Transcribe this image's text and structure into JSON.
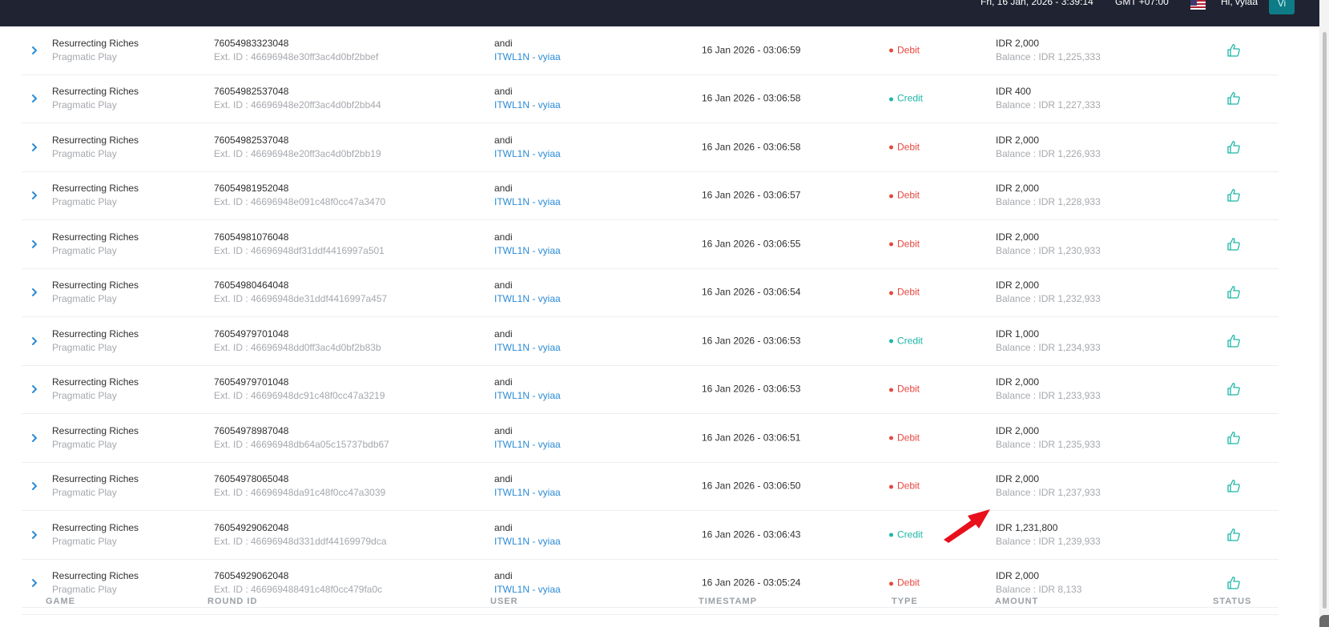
{
  "topbar": {
    "datetime": "Fri, 16 Jan, 2026 - 3:39:14",
    "timezone": "GMT +07:00",
    "greeting": "Hi, vyiaa",
    "avatar_initials": "Vi",
    "flag_icon": "us-flag-icon"
  },
  "table": {
    "headers": [
      "GAME",
      "ROUND ID",
      "USER",
      "TIMESTAMP",
      "TYPE",
      "AMOUNT",
      "STATUS"
    ],
    "rows": [
      {
        "game": "Resurrecting Riches",
        "provider": "Pragmatic Play",
        "round_id": "76054983323048",
        "ext_id": "Ext. ID : 46696948e30ff3ac4d0bf2bbef",
        "user": "andi",
        "user_link": "ITWL1N - vyiaa",
        "timestamp": "16 Jan 2026 - 03:06:59",
        "type": "Debit",
        "amount": "IDR 2,000",
        "balance": "Balance : IDR 1,225,333"
      },
      {
        "game": "Resurrecting Riches",
        "provider": "Pragmatic Play",
        "round_id": "76054982537048",
        "ext_id": "Ext. ID : 46696948e20ff3ac4d0bf2bb44",
        "user": "andi",
        "user_link": "ITWL1N - vyiaa",
        "timestamp": "16 Jan 2026 - 03:06:58",
        "type": "Credit",
        "amount": "IDR 400",
        "balance": "Balance : IDR 1,227,333"
      },
      {
        "game": "Resurrecting Riches",
        "provider": "Pragmatic Play",
        "round_id": "76054982537048",
        "ext_id": "Ext. ID : 46696948e20ff3ac4d0bf2bb19",
        "user": "andi",
        "user_link": "ITWL1N - vyiaa",
        "timestamp": "16 Jan 2026 - 03:06:58",
        "type": "Debit",
        "amount": "IDR 2,000",
        "balance": "Balance : IDR 1,226,933"
      },
      {
        "game": "Resurrecting Riches",
        "provider": "Pragmatic Play",
        "round_id": "76054981952048",
        "ext_id": "Ext. ID : 46696948e091c48f0cc47a3470",
        "user": "andi",
        "user_link": "ITWL1N - vyiaa",
        "timestamp": "16 Jan 2026 - 03:06:57",
        "type": "Debit",
        "amount": "IDR 2,000",
        "balance": "Balance : IDR 1,228,933"
      },
      {
        "game": "Resurrecting Riches",
        "provider": "Pragmatic Play",
        "round_id": "76054981076048",
        "ext_id": "Ext. ID : 46696948df31ddf4416997a501",
        "user": "andi",
        "user_link": "ITWL1N - vyiaa",
        "timestamp": "16 Jan 2026 - 03:06:55",
        "type": "Debit",
        "amount": "IDR 2,000",
        "balance": "Balance : IDR 1,230,933"
      },
      {
        "game": "Resurrecting Riches",
        "provider": "Pragmatic Play",
        "round_id": "76054980464048",
        "ext_id": "Ext. ID : 46696948de31ddf4416997a457",
        "user": "andi",
        "user_link": "ITWL1N - vyiaa",
        "timestamp": "16 Jan 2026 - 03:06:54",
        "type": "Debit",
        "amount": "IDR 2,000",
        "balance": "Balance : IDR 1,232,933"
      },
      {
        "game": "Resurrecting Riches",
        "provider": "Pragmatic Play",
        "round_id": "76054979701048",
        "ext_id": "Ext. ID : 46696948dd0ff3ac4d0bf2b83b",
        "user": "andi",
        "user_link": "ITWL1N - vyiaa",
        "timestamp": "16 Jan 2026 - 03:06:53",
        "type": "Credit",
        "amount": "IDR 1,000",
        "balance": "Balance : IDR 1,234,933"
      },
      {
        "game": "Resurrecting Riches",
        "provider": "Pragmatic Play",
        "round_id": "76054979701048",
        "ext_id": "Ext. ID : 46696948dc91c48f0cc47a3219",
        "user": "andi",
        "user_link": "ITWL1N - vyiaa",
        "timestamp": "16 Jan 2026 - 03:06:53",
        "type": "Debit",
        "amount": "IDR 2,000",
        "balance": "Balance : IDR 1,233,933"
      },
      {
        "game": "Resurrecting Riches",
        "provider": "Pragmatic Play",
        "round_id": "76054978987048",
        "ext_id": "Ext. ID : 46696948db64a05c15737bdb67",
        "user": "andi",
        "user_link": "ITWL1N - vyiaa",
        "timestamp": "16 Jan 2026 - 03:06:51",
        "type": "Debit",
        "amount": "IDR 2,000",
        "balance": "Balance : IDR 1,235,933"
      },
      {
        "game": "Resurrecting Riches",
        "provider": "Pragmatic Play",
        "round_id": "76054978065048",
        "ext_id": "Ext. ID : 46696948da91c48f0cc47a3039",
        "user": "andi",
        "user_link": "ITWL1N - vyiaa",
        "timestamp": "16 Jan 2026 - 03:06:50",
        "type": "Debit",
        "amount": "IDR 2,000",
        "balance": "Balance : IDR 1,237,933"
      },
      {
        "game": "Resurrecting Riches",
        "provider": "Pragmatic Play",
        "round_id": "76054929062048",
        "ext_id": "Ext. ID : 46696948d331ddf44169979dca",
        "user": "andi",
        "user_link": "ITWL1N - vyiaa",
        "timestamp": "16 Jan 2026 - 03:06:43",
        "type": "Credit",
        "amount": "IDR 1,231,800",
        "balance": "Balance : IDR 1,239,933"
      },
      {
        "game": "Resurrecting Riches",
        "provider": "Pragmatic Play",
        "round_id": "76054929062048",
        "ext_id": "Ext. ID : 466969488491c48f0cc479fa0c",
        "user": "andi",
        "user_link": "ITWL1N - vyiaa",
        "timestamp": "16 Jan 2026 - 03:05:24",
        "type": "Debit",
        "amount": "IDR 2,000",
        "balance": "Balance : IDR 8,133"
      }
    ]
  },
  "colors": {
    "topbar": "#202332",
    "debit": "#e8463f",
    "credit": "#1cb6a6",
    "link": "#2b8bd6",
    "status_icon": "#1cb6a6",
    "annotation_arrow": "#e8101a"
  },
  "icons": {
    "expand": "chevron-right-icon",
    "status": "thumbs-up-icon",
    "annotation": "red-arrow-icon"
  }
}
